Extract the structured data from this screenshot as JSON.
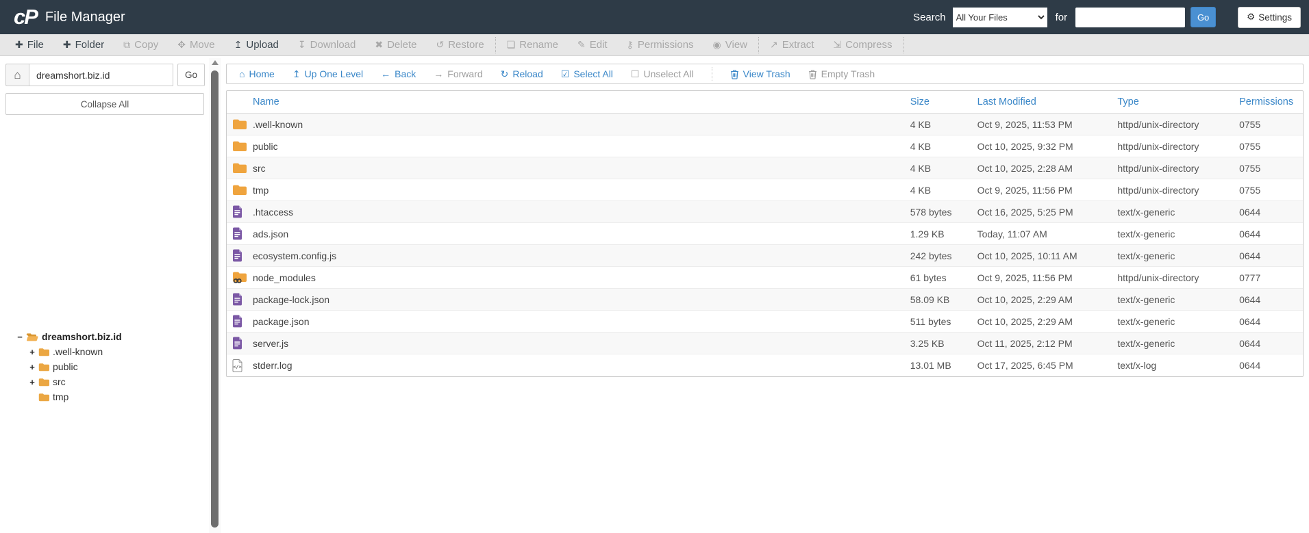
{
  "header": {
    "logo_text": "cP",
    "app_title": "File Manager",
    "search_label": "Search",
    "search_scope_selected": "All Your Files",
    "search_connector": "for",
    "search_value": "",
    "go_label": "Go",
    "settings_label": "Settings",
    "settings_icon": "⚙"
  },
  "toolbar": {
    "items": [
      {
        "label": "File",
        "glyph": "✚",
        "icon": "add-file-icon",
        "enabled": true,
        "sep_after": false
      },
      {
        "label": "Folder",
        "glyph": "✚",
        "icon": "add-folder-icon",
        "enabled": true,
        "sep_after": false
      },
      {
        "label": "Copy",
        "glyph": "⧉",
        "icon": "copy-icon",
        "enabled": false,
        "sep_after": false
      },
      {
        "label": "Move",
        "glyph": "✥",
        "icon": "move-icon",
        "enabled": false,
        "sep_after": false
      },
      {
        "label": "Upload",
        "glyph": "↥",
        "icon": "upload-icon",
        "enabled": true,
        "sep_after": false
      },
      {
        "label": "Download",
        "glyph": "↧",
        "icon": "download-icon",
        "enabled": false,
        "sep_after": false
      },
      {
        "label": "Delete",
        "glyph": "✖",
        "icon": "delete-icon",
        "enabled": false,
        "sep_after": false
      },
      {
        "label": "Restore",
        "glyph": "↺",
        "icon": "restore-icon",
        "enabled": false,
        "sep_after": true
      },
      {
        "label": "Rename",
        "glyph": "❏",
        "icon": "rename-icon",
        "enabled": false,
        "sep_after": false
      },
      {
        "label": "Edit",
        "glyph": "✎",
        "icon": "edit-icon",
        "enabled": false,
        "sep_after": false
      },
      {
        "label": "Permissions",
        "glyph": "⚷",
        "icon": "permissions-icon",
        "enabled": false,
        "sep_after": false
      },
      {
        "label": "View",
        "glyph": "◉",
        "icon": "view-icon",
        "enabled": false,
        "sep_after": true
      },
      {
        "label": "Extract",
        "glyph": "↗",
        "icon": "extract-icon",
        "enabled": false,
        "sep_after": false
      },
      {
        "label": "Compress",
        "glyph": "⇲",
        "icon": "compress-icon",
        "enabled": false,
        "sep_after": true
      }
    ]
  },
  "sidebar": {
    "path_value": "dreamshort.biz.id",
    "go_label": "Go",
    "collapse_all_label": "Collapse All",
    "tree": [
      {
        "label": "dreamshort.biz.id",
        "expander": "−",
        "icon": "open-folder-icon",
        "root": true
      },
      {
        "label": ".well-known",
        "expander": "+",
        "icon": "closed-folder-icon",
        "root": false
      },
      {
        "label": "public",
        "expander": "+",
        "icon": "closed-folder-icon",
        "root": false
      },
      {
        "label": "src",
        "expander": "+",
        "icon": "closed-folder-icon",
        "root": false
      },
      {
        "label": "tmp",
        "expander": "",
        "icon": "closed-folder-icon",
        "root": false
      }
    ]
  },
  "nav": {
    "items": [
      {
        "label": "Home",
        "icon": "home-icon",
        "enabled": true,
        "sep_before": false
      },
      {
        "label": "Up One Level",
        "icon": "up-one-level-icon",
        "enabled": true,
        "sep_before": false
      },
      {
        "label": "Back",
        "icon": "back-arrow-icon",
        "enabled": true,
        "sep_before": false
      },
      {
        "label": "Forward",
        "icon": "forward-arrow-icon",
        "enabled": false,
        "sep_before": false
      },
      {
        "label": "Reload",
        "icon": "reload-icon",
        "enabled": true,
        "sep_before": false
      },
      {
        "label": "Select All",
        "icon": "checkbox-checked-icon",
        "enabled": true,
        "sep_before": false
      },
      {
        "label": "Unselect All",
        "icon": "checkbox-empty-icon",
        "enabled": false,
        "sep_before": false
      },
      {
        "label": "View Trash",
        "icon": "trash-icon",
        "enabled": true,
        "sep_before": true
      },
      {
        "label": "Empty Trash",
        "icon": "trash-icon",
        "enabled": false,
        "sep_before": false
      }
    ]
  },
  "table": {
    "columns": [
      "Name",
      "Size",
      "Last Modified",
      "Type",
      "Permissions"
    ],
    "rows": [
      {
        "name": ".well-known",
        "icon": "folder-icon",
        "size": "4 KB",
        "modified": "Oct 9, 2025, 11:53 PM",
        "type": "httpd/unix-directory",
        "permissions": "0755"
      },
      {
        "name": "public",
        "icon": "folder-icon",
        "size": "4 KB",
        "modified": "Oct 10, 2025, 9:32 PM",
        "type": "httpd/unix-directory",
        "permissions": "0755"
      },
      {
        "name": "src",
        "icon": "folder-icon",
        "size": "4 KB",
        "modified": "Oct 10, 2025, 2:28 AM",
        "type": "httpd/unix-directory",
        "permissions": "0755"
      },
      {
        "name": "tmp",
        "icon": "folder-icon",
        "size": "4 KB",
        "modified": "Oct 9, 2025, 11:56 PM",
        "type": "httpd/unix-directory",
        "permissions": "0755"
      },
      {
        "name": ".htaccess",
        "icon": "document-icon",
        "size": "578 bytes",
        "modified": "Oct 16, 2025, 5:25 PM",
        "type": "text/x-generic",
        "permissions": "0644"
      },
      {
        "name": "ads.json",
        "icon": "document-icon",
        "size": "1.29 KB",
        "modified": "Today, 11:07 AM",
        "type": "text/x-generic",
        "permissions": "0644"
      },
      {
        "name": "ecosystem.config.js",
        "icon": "document-icon",
        "size": "242 bytes",
        "modified": "Oct 10, 2025, 10:11 AM",
        "type": "text/x-generic",
        "permissions": "0644"
      },
      {
        "name": "node_modules",
        "icon": "symlink-folder-icon",
        "size": "61 bytes",
        "modified": "Oct 9, 2025, 11:56 PM",
        "type": "httpd/unix-directory",
        "permissions": "0777"
      },
      {
        "name": "package-lock.json",
        "icon": "document-icon",
        "size": "58.09 KB",
        "modified": "Oct 10, 2025, 2:29 AM",
        "type": "text/x-generic",
        "permissions": "0644"
      },
      {
        "name": "package.json",
        "icon": "document-icon",
        "size": "511 bytes",
        "modified": "Oct 10, 2025, 2:29 AM",
        "type": "text/x-generic",
        "permissions": "0644"
      },
      {
        "name": "server.js",
        "icon": "document-icon",
        "size": "3.25 KB",
        "modified": "Oct 11, 2025, 2:12 PM",
        "type": "text/x-generic",
        "permissions": "0644"
      },
      {
        "name": "stderr.log",
        "icon": "log-file-icon",
        "size": "13.01 MB",
        "modified": "Oct 17, 2025, 6:45 PM",
        "type": "text/x-log",
        "permissions": "0644"
      }
    ]
  },
  "colors": {
    "header_bg": "#2e3b47",
    "toolbar_bg": "#e7e7e7",
    "link_blue": "#3a87c8",
    "go_button_blue": "#4a90d2",
    "folder_orange": "#efa43e",
    "document_purple": "#7b58a5",
    "disabled_gray": "#a8a8a8"
  }
}
